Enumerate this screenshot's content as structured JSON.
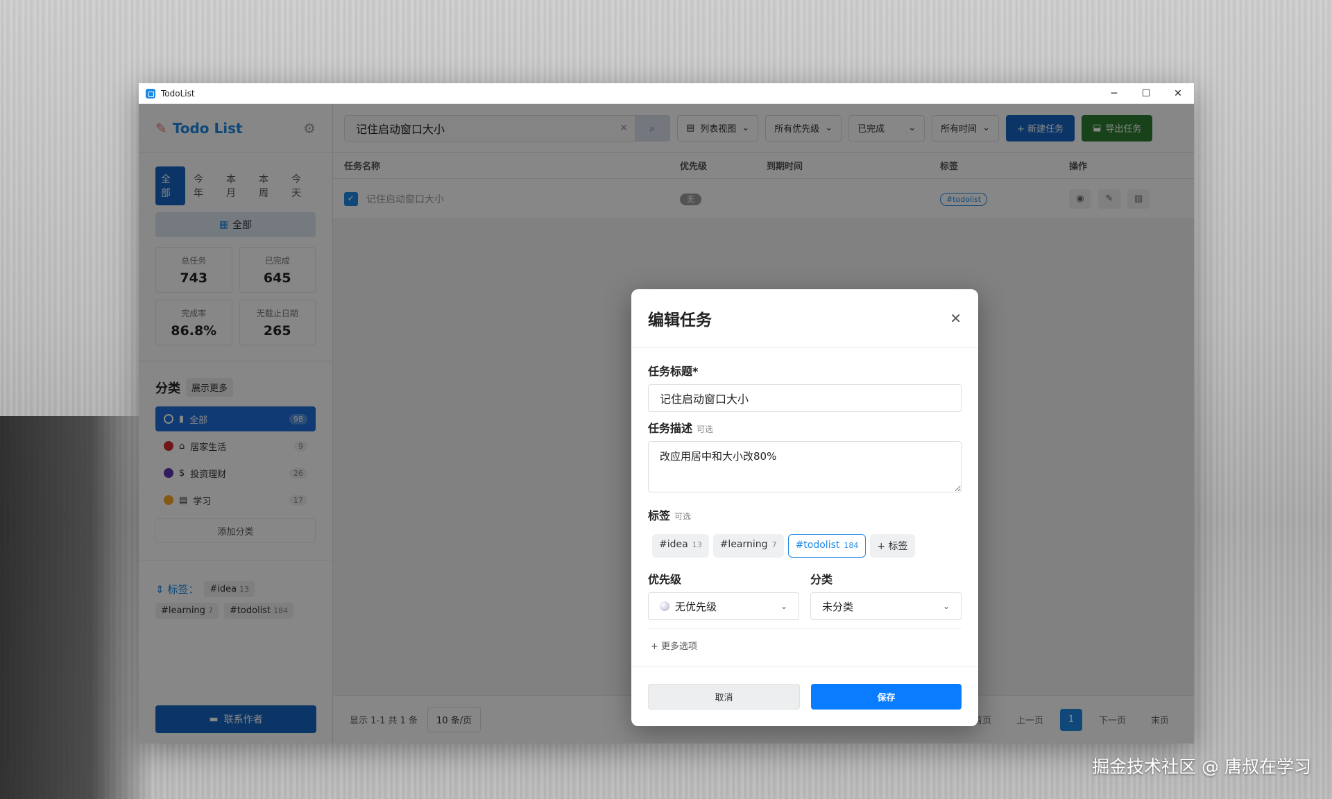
{
  "window": {
    "title": "TodoList",
    "controls": {
      "minimize": "─",
      "maximize": "☐",
      "close": "✕"
    }
  },
  "sidebar": {
    "logo": "Todo List",
    "period_tabs": [
      "全部",
      "今年",
      "本月",
      "本周",
      "今天"
    ],
    "active_period": "全部",
    "all_button": "全部",
    "stats": [
      {
        "label": "总任务",
        "value": "743"
      },
      {
        "label": "已完成",
        "value": "645"
      },
      {
        "label": "完成率",
        "value": "86.8%"
      },
      {
        "label": "无截止日期",
        "value": "265"
      }
    ],
    "categories_title": "分类",
    "show_more": "展示更多",
    "categories": [
      {
        "label": "全部",
        "count": "98",
        "color": "#1e6fd9"
      },
      {
        "label": "居家生活",
        "count": "9",
        "color": "#d32f2f"
      },
      {
        "label": "投资理财",
        "count": "26",
        "color": "#5e35b1"
      },
      {
        "label": "学习",
        "count": "17",
        "color": "#f9a825"
      }
    ],
    "add_category": "添加分类",
    "tags_label": "标签：",
    "tags": [
      {
        "name": "#idea",
        "count": "13"
      },
      {
        "name": "#learning",
        "count": "7"
      },
      {
        "name": "#todolist",
        "count": "184"
      }
    ],
    "contact": "联系作者"
  },
  "toolbar": {
    "search_value": "记住启动窗口大小",
    "view": "列表视图",
    "priority_filter": "所有优先级",
    "status_filter": "已完成",
    "time_filter": "所有时间",
    "new_task": "+ 新建任务",
    "export": "导出任务"
  },
  "table": {
    "headers": {
      "name": "任务名称",
      "priority": "优先级",
      "due": "到期时间",
      "tags": "标签",
      "actions": "操作"
    },
    "rows": [
      {
        "name": "记住启动窗口大小",
        "priority": "无",
        "due": "",
        "tag": "#todolist"
      }
    ]
  },
  "pager": {
    "summary": "显示 1-1 共 1 条",
    "page_size": "10 条/页",
    "first": "首页",
    "prev": "上一页",
    "current": "1",
    "next": "下一页",
    "last": "末页"
  },
  "modal": {
    "title": "编辑任务",
    "title_label": "任务标题*",
    "title_value": "记住启动窗口大小",
    "desc_label": "任务描述",
    "optional": "可选",
    "desc_value": "改应用居中和大小改80%",
    "tags_label": "标签",
    "tags": [
      {
        "name": "#idea",
        "count": "13",
        "selected": false
      },
      {
        "name": "#learning",
        "count": "7",
        "selected": false
      },
      {
        "name": "#todolist",
        "count": "184",
        "selected": true
      }
    ],
    "add_tag": "+ 标签",
    "priority_label": "优先级",
    "priority_value": "无优先级",
    "category_label": "分类",
    "category_value": "未分类",
    "more_options": "更多选项",
    "cancel": "取消",
    "save": "保存"
  },
  "watermark": "掘金技术社区 @ 唐叔在学习"
}
